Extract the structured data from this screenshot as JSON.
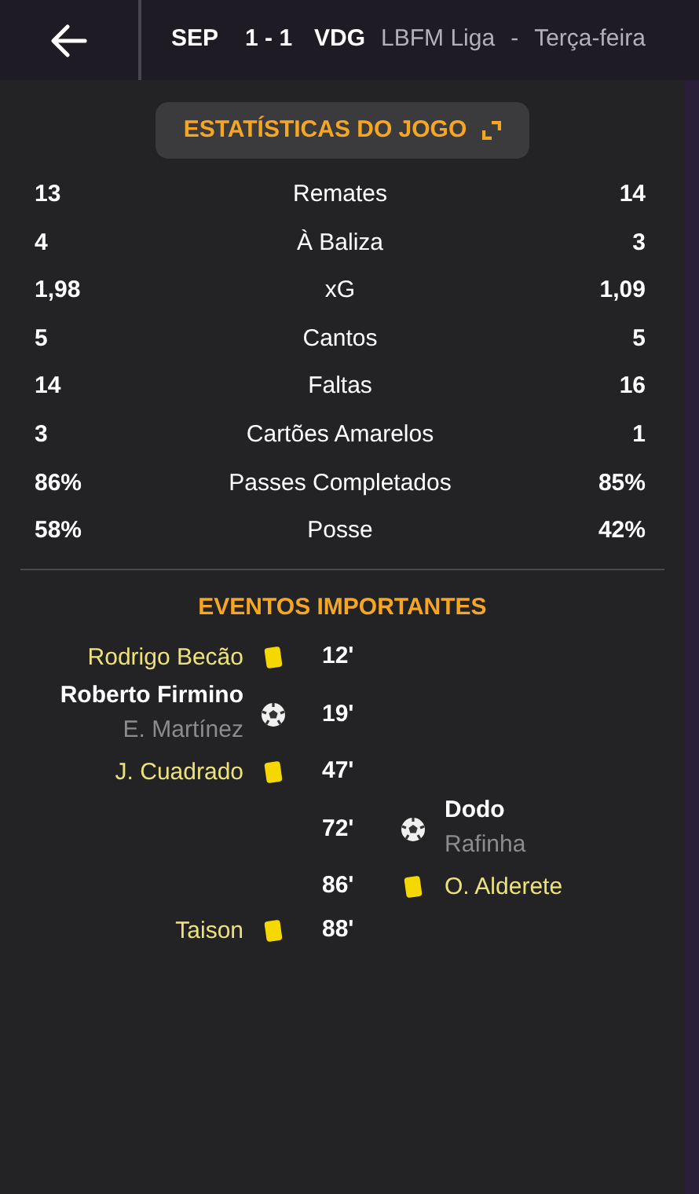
{
  "header": {
    "home": "SEP",
    "score": "1 - 1",
    "away": "VDG",
    "competition": "LBFM Liga",
    "separator": "-",
    "date": "Terça-feira"
  },
  "stats_button": {
    "label": "ESTATÍSTICAS DO JOGO"
  },
  "stats": [
    {
      "home": "13",
      "label": "Remates",
      "away": "14"
    },
    {
      "home": "4",
      "label": "À Baliza",
      "away": "3"
    },
    {
      "home": "1,98",
      "label": "xG",
      "away": "1,09"
    },
    {
      "home": "5",
      "label": "Cantos",
      "away": "5"
    },
    {
      "home": "14",
      "label": "Faltas",
      "away": "16"
    },
    {
      "home": "3",
      "label": "Cartões Amarelos",
      "away": "1"
    },
    {
      "home": "86%",
      "label": "Passes Completados",
      "away": "85%"
    },
    {
      "home": "58%",
      "label": "Posse",
      "away": "42%"
    }
  ],
  "events_title": "EVENTOS IMPORTANTES",
  "events": [
    {
      "kind": "yellow",
      "away_team": false,
      "player": "Rodrigo Becão",
      "minute": "12'"
    },
    {
      "kind": "goal",
      "away_team": false,
      "player": "Roberto Firmino",
      "assist": "E. Martínez",
      "minute": "19'"
    },
    {
      "kind": "yellow",
      "away_team": false,
      "player": "J. Cuadrado",
      "minute": "47'"
    },
    {
      "kind": "goal",
      "away_team": true,
      "player": "Dodo",
      "assist": "Rafinha",
      "minute": "72'"
    },
    {
      "kind": "yellow",
      "away_team": true,
      "player": "O. Alderete",
      "minute": "86'"
    },
    {
      "kind": "yellow",
      "away_team": false,
      "player": "Taison",
      "minute": "88'"
    }
  ]
}
